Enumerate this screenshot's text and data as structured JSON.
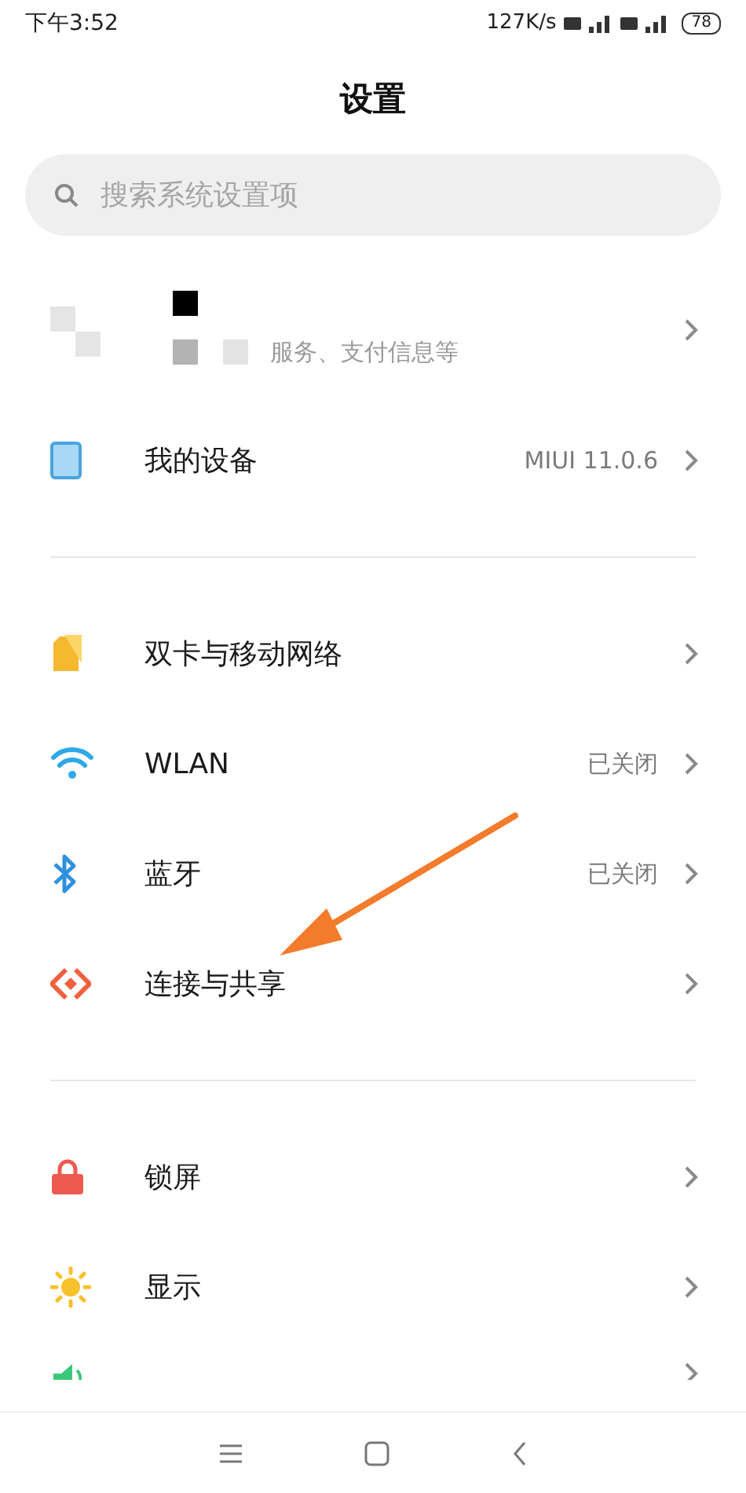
{
  "status_bar": {
    "time": "下午3:52",
    "speed": "127K/s",
    "battery": "78"
  },
  "title": "设置",
  "search": {
    "placeholder": "搜索系统设置项"
  },
  "account": {
    "subtitle": "服务、支付信息等"
  },
  "groups": [
    [
      {
        "kind": "device",
        "label": "我的设备",
        "value": "MIUI 11.0.6"
      }
    ],
    [
      {
        "kind": "sim",
        "label": "双卡与移动网络"
      },
      {
        "kind": "wifi",
        "label": "WLAN",
        "value": "已关闭"
      },
      {
        "kind": "bluetooth",
        "label": "蓝牙",
        "value": "已关闭"
      },
      {
        "kind": "share",
        "label": "连接与共享"
      }
    ],
    [
      {
        "kind": "lock",
        "label": "锁屏"
      },
      {
        "kind": "sun",
        "label": "显示"
      },
      {
        "kind": "sound",
        "cut": true
      }
    ]
  ]
}
